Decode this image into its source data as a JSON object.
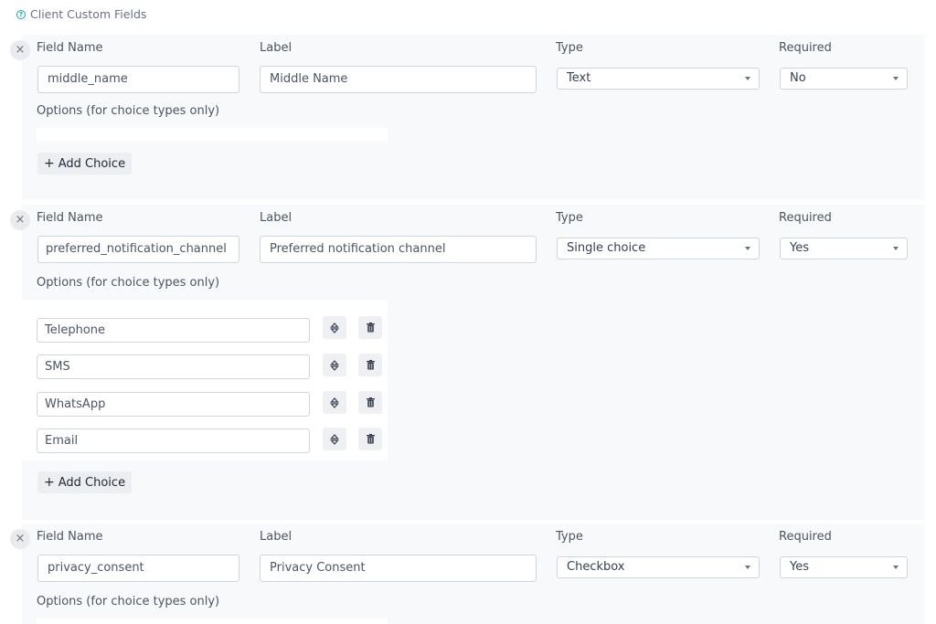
{
  "section": {
    "title": "Client Custom Fields",
    "help_icon": "?"
  },
  "labels": {
    "field_name": "Field Name",
    "label": "Label",
    "type": "Type",
    "required": "Required",
    "options": "Options (for choice types only)",
    "add_choice": "Add Choice",
    "remove_icon": "×",
    "plus_icon": "+"
  },
  "fields": [
    {
      "field_name": "middle_name",
      "label": "Middle Name",
      "type": "Text",
      "required": "No",
      "options": []
    },
    {
      "field_name": "preferred_notification_channel",
      "label": "Preferred notification channel",
      "type": "Single choice",
      "required": "Yes",
      "options": [
        "Telephone",
        "SMS",
        "WhatsApp",
        "Email"
      ]
    },
    {
      "field_name": "privacy_consent",
      "label": "Privacy Consent",
      "type": "Checkbox",
      "required": "Yes",
      "options": []
    }
  ]
}
